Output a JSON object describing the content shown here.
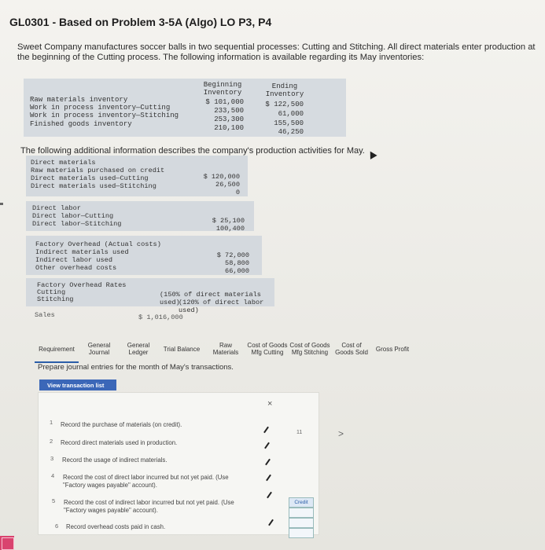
{
  "title": "GL0301 - Based on Problem 3-5A (Algo) LO P3, P4",
  "intro": "Sweet Company manufactures soccer balls in two sequential processes: Cutting and Stitching. All direct materials enter production at the beginning of the Cutting process. The following information is available regarding its May inventories:",
  "inventory_table": {
    "col1_head": [
      "Beginning",
      "Inventory"
    ],
    "col2_head": [
      "Ending",
      "Inventory"
    ],
    "rows": [
      {
        "label": "Raw materials inventory",
        "begin": "$ 101,000",
        "end": "$ 122,500"
      },
      {
        "label": "Work in process inventory—Cutting",
        "begin": "233,500",
        "end": "61,000"
      },
      {
        "label": "Work in process inventory—Stitching",
        "begin": "253,300",
        "end": "155,500"
      },
      {
        "label": "Finished goods inventory",
        "begin": "210,100",
        "end": "46,250"
      }
    ]
  },
  "following": "The following additional information describes the company's production activities for May.",
  "direct_materials": {
    "heading": "Direct materials",
    "rows": [
      {
        "label": "Raw materials purchased on credit",
        "value": ""
      },
      {
        "label": "Direct materials used—Cutting",
        "value": "$ 120,000"
      },
      {
        "label": "Direct materials used—Stitching",
        "value": "26,500"
      }
    ],
    "extra_value": "0"
  },
  "direct_labor": {
    "heading": "Direct labor",
    "rows": [
      {
        "label": "Direct labor—Cutting",
        "value": "$ 25,100"
      },
      {
        "label": "Direct labor—Stitching",
        "value": "100,400"
      }
    ]
  },
  "overhead": {
    "heading": "Factory Overhead (Actual costs)",
    "rows": [
      {
        "label": "Indirect materials used",
        "value": "$ 72,000"
      },
      {
        "label": "Indirect labor used",
        "value": "58,800"
      },
      {
        "label": "Other overhead costs",
        "value": "66,000"
      }
    ]
  },
  "rates": {
    "heading": "Factory Overhead Rates",
    "rows": [
      {
        "label": "Cutting",
        "value": "(150% of direct materials used)"
      },
      {
        "label": "Stitching",
        "value": "(120% of direct labor used)"
      }
    ]
  },
  "sales": {
    "label": "Sales",
    "value": "$ 1,016,000"
  },
  "tabs": [
    {
      "label": "Requirement"
    },
    {
      "label": "General Journal"
    },
    {
      "label": "General Ledger"
    },
    {
      "label": "Trial Balance"
    },
    {
      "label": "Raw Materials"
    },
    {
      "label": "Cost of Goods Mfg Cutting"
    },
    {
      "label": "Cost of Goods Mfg Stitching"
    },
    {
      "label": "Cost of Goods Sold"
    },
    {
      "label": "Gross Profit"
    }
  ],
  "prepare": "Prepare journal entries for the month of May's transactions.",
  "view_button": "View transaction list",
  "close": "×",
  "transactions": [
    {
      "num": "1",
      "text": "Record the purchase of materials (on credit)."
    },
    {
      "num": "2",
      "text": "Record direct materials used in production."
    },
    {
      "num": "3",
      "text": "Record the usage of indirect materials."
    },
    {
      "num": "4",
      "text": "Record the cost of direct labor incurred but not yet paid. (Use \"Factory wages payable\" account)."
    },
    {
      "num": "5",
      "text": "Record the cost of indirect labor incurred but not yet paid. (Use \"Factory wages payable\" account)."
    },
    {
      "num": "6",
      "text": "Record overhead costs paid in cash."
    }
  ],
  "side_number": "11",
  "chevron": ">",
  "credit_label": "Credit"
}
